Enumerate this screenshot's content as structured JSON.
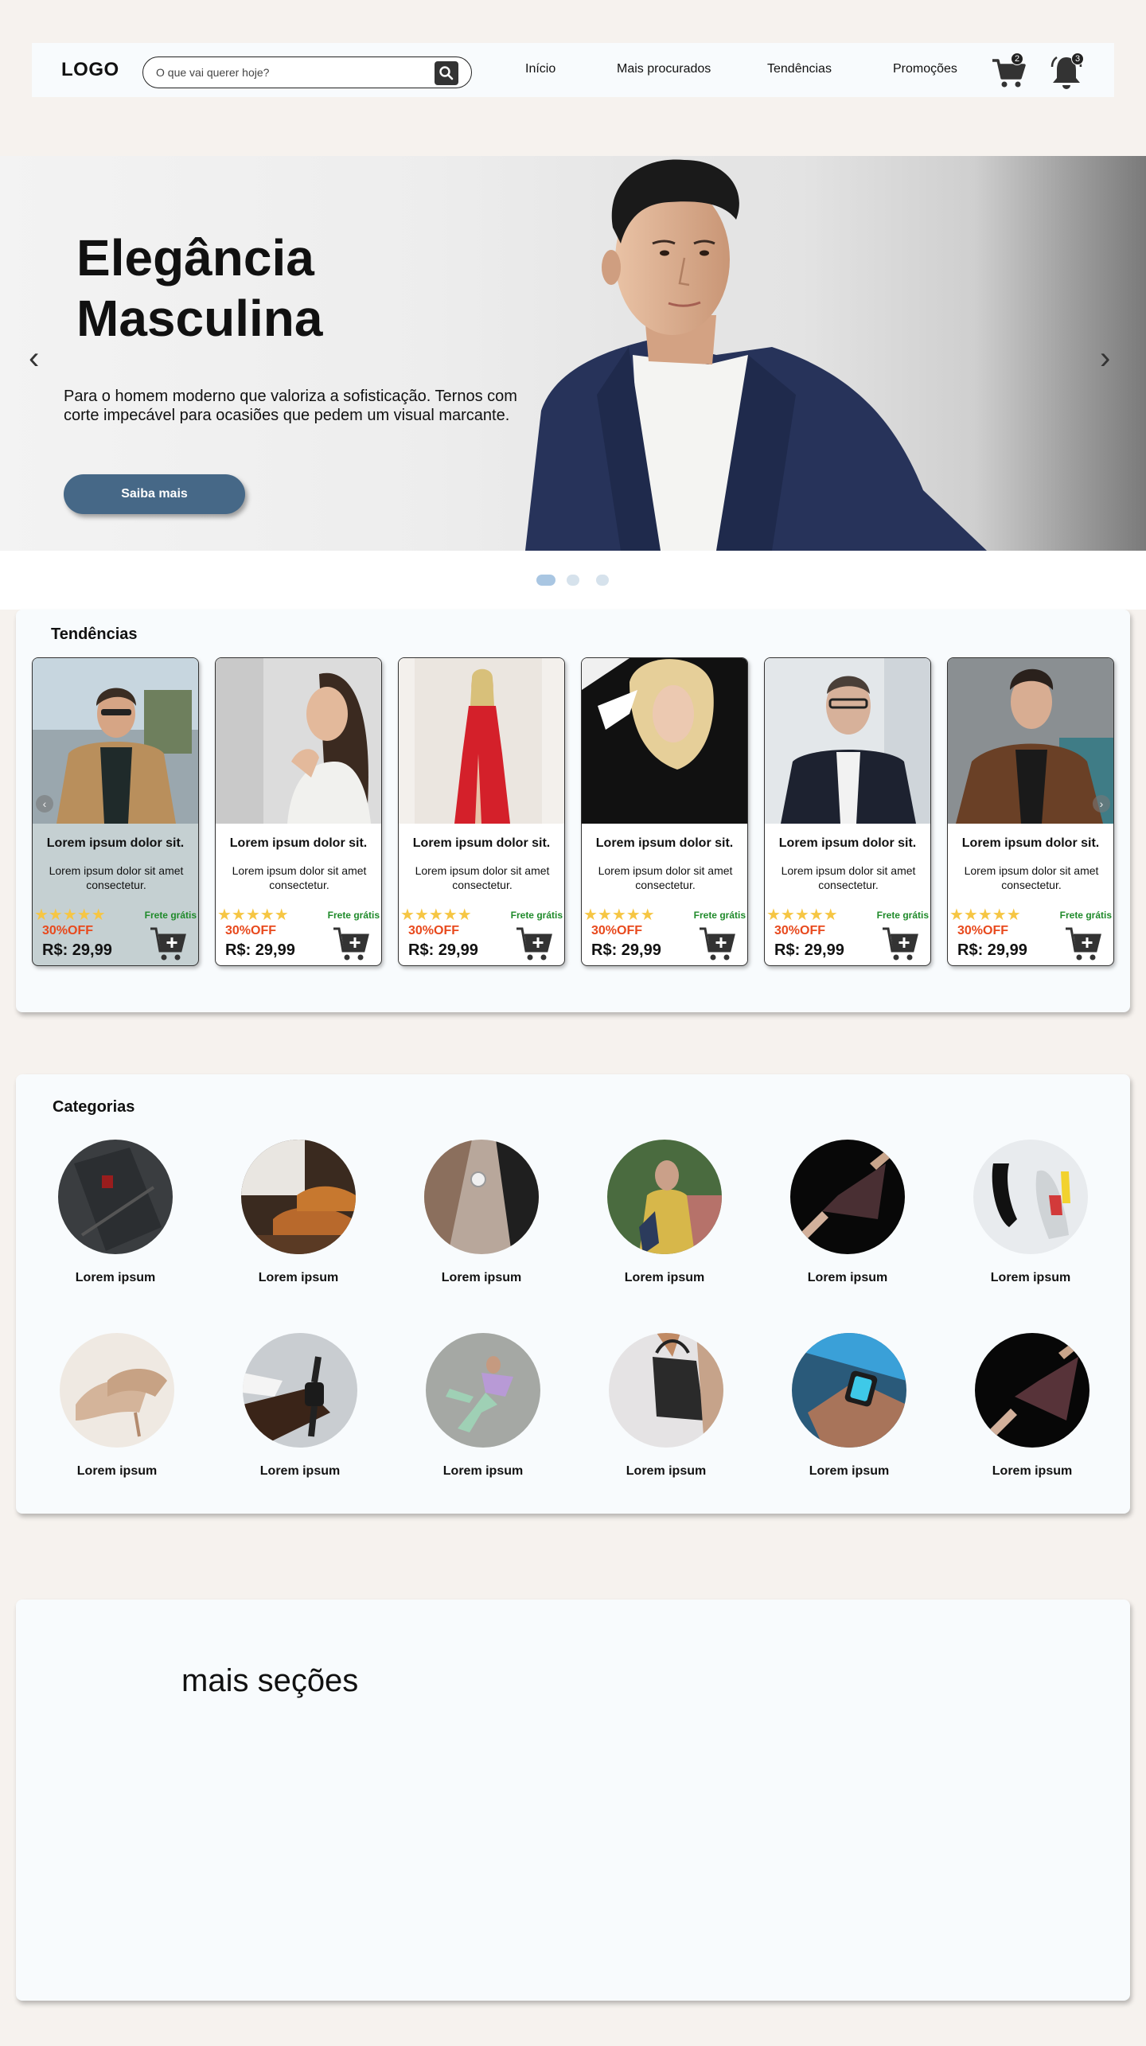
{
  "header": {
    "logo": "LOGO",
    "search_placeholder": "O que vai querer hoje?",
    "nav": [
      "Início",
      "Mais procurados",
      "Tendências",
      "Promoções"
    ],
    "cart_count": "2",
    "notification_count": "3"
  },
  "hero": {
    "title_line1": "Elegância",
    "title_line2": "Masculina",
    "description": "Para o homem moderno que valoriza a sofisticação. Ternos com corte impecável para ocasiões que pedem um visual marcante.",
    "button_label": "Saiba mais",
    "prev_arrow": "‹",
    "next_arrow": "›",
    "active_slide": 1,
    "slide_count": 3
  },
  "trends": {
    "title": "Tendências",
    "products": [
      {
        "title": "Lorem ipsum dolor sit.",
        "desc": "Lorem ipsum dolor sit amet consectetur.",
        "stars": "★★★★★",
        "shipping": "Frete grátis",
        "discount": "30%OFF",
        "price": "R$: 29,99"
      },
      {
        "title": "Lorem ipsum dolor sit.",
        "desc": "Lorem ipsum dolor sit amet consectetur.",
        "stars": "★★★★★",
        "shipping": "Frete grátis",
        "discount": "30%OFF",
        "price": "R$: 29,99"
      },
      {
        "title": "Lorem ipsum dolor sit.",
        "desc": "Lorem ipsum dolor sit amet consectetur.",
        "stars": "★★★★★",
        "shipping": "Frete grátis",
        "discount": "30%OFF",
        "price": "R$: 29,99"
      },
      {
        "title": "Lorem ipsum dolor sit.",
        "desc": "Lorem ipsum dolor sit amet consectetur.",
        "stars": "★★★★★",
        "shipping": "Frete grátis",
        "discount": "30%OFF",
        "price": "R$: 29,99"
      },
      {
        "title": "Lorem ipsum dolor sit.",
        "desc": "Lorem ipsum dolor sit amet consectetur.",
        "stars": "★★★★★",
        "shipping": "Frete grátis",
        "discount": "30%OFF",
        "price": "R$: 29,99"
      },
      {
        "title": "Lorem ipsum dolor sit.",
        "desc": "Lorem ipsum dolor sit amet consectetur.",
        "stars": "★★★★★",
        "shipping": "Frete grátis",
        "discount": "30%OFF",
        "price": "R$: 29,99"
      }
    ],
    "prev_arrow": "‹",
    "next_arrow": "›"
  },
  "categories": {
    "title": "Categorias",
    "items": [
      {
        "label": "Lorem ipsum"
      },
      {
        "label": "Lorem ipsum"
      },
      {
        "label": "Lorem ipsum"
      },
      {
        "label": "Lorem ipsum"
      },
      {
        "label": "Lorem ipsum"
      },
      {
        "label": "Lorem ipsum"
      },
      {
        "label": "Lorem ipsum"
      },
      {
        "label": "Lorem ipsum"
      },
      {
        "label": "Lorem ipsum"
      },
      {
        "label": "Lorem ipsum"
      },
      {
        "label": "Lorem ipsum"
      },
      {
        "label": "Lorem ipsum"
      }
    ]
  },
  "more": {
    "title": "mais seções"
  },
  "colors": {
    "page_bg": "#f6f2ee",
    "panel_bg": "#f8fbfd",
    "primary_button": "#466887",
    "discount": "#e8491d",
    "shipping": "#1f8a2a",
    "stars": "#f6c644",
    "dot_active": "#a9c6e2"
  },
  "icons": [
    "search-icon",
    "cart-icon",
    "bell-icon",
    "add-to-cart-icon",
    "chevron-left-icon",
    "chevron-right-icon"
  ]
}
